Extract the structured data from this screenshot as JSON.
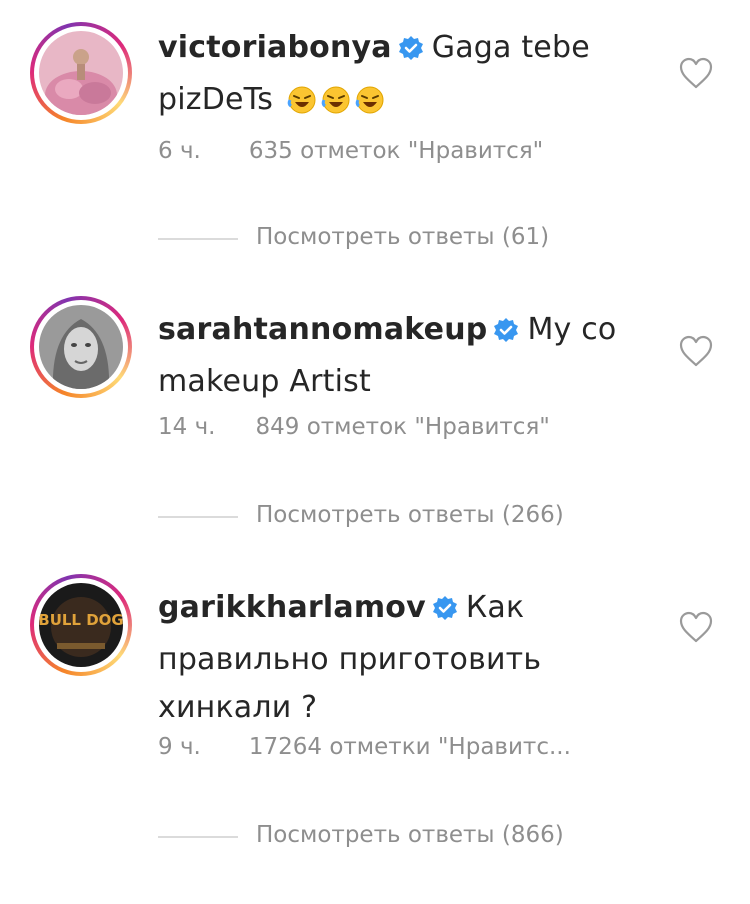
{
  "comments": [
    {
      "username": "victoriabonya",
      "text": "Gaga tebe pizDeTs",
      "emoji_count": 3,
      "time": "6 ч.",
      "likes": "635 отметок \"Нравится\"",
      "view_replies": "Посмотреть ответы (61)"
    },
    {
      "username": "sarahtannomakeup",
      "text": "My co makeup Artist",
      "time": "14 ч.",
      "likes": "849 отметок \"Нравится\"",
      "view_replies": "Посмотреть ответы (266)"
    },
    {
      "username": "garikkharlamov",
      "text": "Как правильно приготовить хинкали ?",
      "time": "9 ч.",
      "likes": "17264 отметки \"Нравитс...",
      "view_replies": "Посмотреть ответы (866)",
      "avatar_logo": "BULL DOG"
    }
  ],
  "colors": {
    "verified": "#3897f0",
    "meta_text": "#8e8e8e",
    "username": "#262626"
  }
}
